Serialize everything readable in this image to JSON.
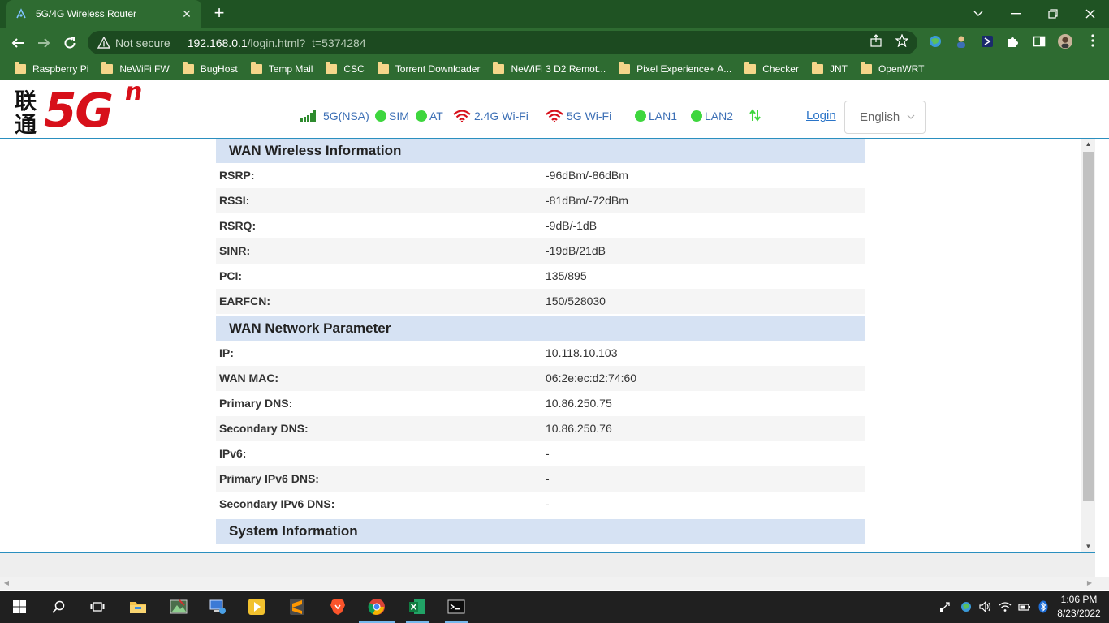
{
  "browser": {
    "tab_title": "5G/4G Wireless Router",
    "not_secure_label": "Not secure",
    "url_host": "192.168.0.1",
    "url_path": "/login.html?_t=5374284"
  },
  "bookmarks": [
    {
      "label": "Raspberry Pi"
    },
    {
      "label": "NeWiFi FW"
    },
    {
      "label": "BugHost"
    },
    {
      "label": "Temp Mail"
    },
    {
      "label": "CSC"
    },
    {
      "label": "Torrent Downloader"
    },
    {
      "label": "NeWiFi 3 D2 Remot..."
    },
    {
      "label": "Pixel Experience+ A..."
    },
    {
      "label": "Checker"
    },
    {
      "label": "JNT"
    },
    {
      "label": "OpenWRT"
    }
  ],
  "header": {
    "logo_cn": "联通",
    "logo_5g": "5G",
    "logo_sup": "n",
    "status": {
      "network": "5G(NSA)",
      "sim": "SIM",
      "at": "AT",
      "wifi24": "2.4G Wi-Fi",
      "wifi5": "5G Wi-Fi",
      "lan1": "LAN1",
      "lan2": "LAN2"
    },
    "login_label": "Login",
    "language": "English"
  },
  "sections": {
    "wireless": {
      "title": "WAN Wireless Information",
      "rows": [
        {
          "label": "RSRP:",
          "value": "-96dBm/-86dBm"
        },
        {
          "label": "RSSI:",
          "value": "-81dBm/-72dBm"
        },
        {
          "label": "RSRQ:",
          "value": "-9dB/-1dB"
        },
        {
          "label": "SINR:",
          "value": "-19dB/21dB"
        },
        {
          "label": "PCI:",
          "value": "135/895"
        },
        {
          "label": "EARFCN:",
          "value": "150/528030"
        }
      ]
    },
    "network": {
      "title": "WAN Network Parameter",
      "rows": [
        {
          "label": "IP:",
          "value": "10.118.10.103"
        },
        {
          "label": "WAN MAC:",
          "value": "06:2e:ec:d2:74:60"
        },
        {
          "label": "Primary DNS:",
          "value": "10.86.250.75"
        },
        {
          "label": "Secondary DNS:",
          "value": "10.86.250.76"
        },
        {
          "label": "IPv6:",
          "value": "-"
        },
        {
          "label": "Primary IPv6 DNS:",
          "value": "-"
        },
        {
          "label": "Secondary IPv6 DNS:",
          "value": "-"
        }
      ]
    },
    "system": {
      "title": "System Information"
    }
  },
  "taskbar": {
    "time": "1:06 PM",
    "date": "8/23/2022"
  },
  "colors": {
    "chrome_frame": "#1f5323",
    "chrome_toolbar": "#2e6b31",
    "brand_red": "#d7101a",
    "section_header_bg": "#d6e2f3",
    "status_text": "#3c6fb5",
    "status_dot": "#3ed63e"
  }
}
